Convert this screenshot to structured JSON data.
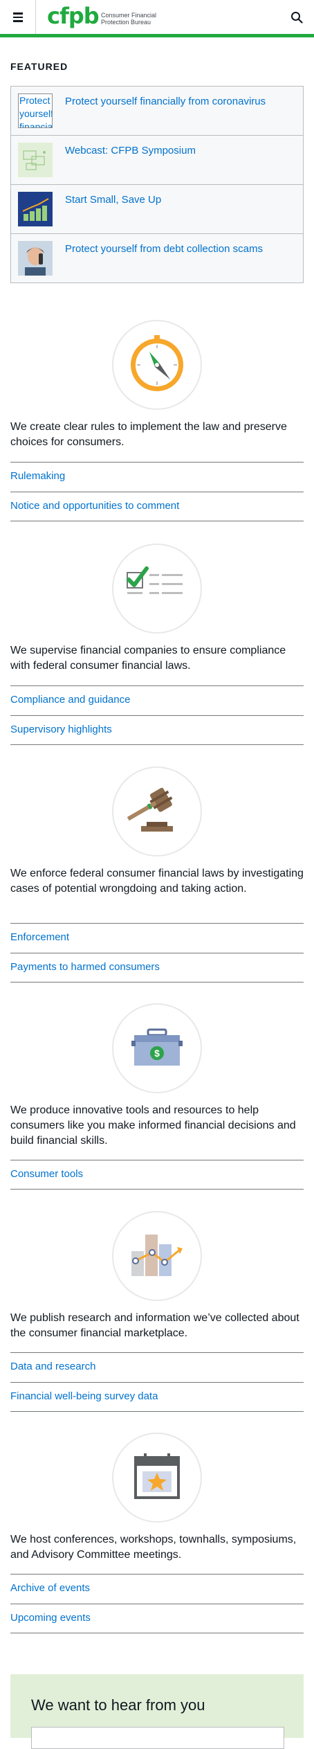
{
  "header": {
    "logo_text": "cfpb",
    "logo_subtitle_1": "Consumer Financial",
    "logo_subtitle_2": "Protection Bureau",
    "menu_icon": "hamburger-icon",
    "search_icon": "search-icon"
  },
  "featured": {
    "title": "FEATURED",
    "items": [
      {
        "label": "Protect yourself financially from coronavirus",
        "thumb_alt": "Protect yourself financially"
      },
      {
        "label": "Webcast: CFPB Symposium"
      },
      {
        "label": "Start Small, Save Up"
      },
      {
        "label": "Protect yourself from debt collection scams"
      }
    ]
  },
  "sections": [
    {
      "icon": "compass-icon",
      "text": "We create clear rules to implement the law and preserve choices for consumers.",
      "links": [
        "Rulemaking",
        "Notice and opportunities to comment"
      ]
    },
    {
      "icon": "checklist-icon",
      "text": "We supervise financial companies to ensure compliance with federal consumer financial laws.",
      "links": [
        "Compliance and guidance",
        "Supervisory highlights"
      ]
    },
    {
      "icon": "gavel-icon",
      "text": "We enforce federal consumer financial laws by investigating cases of potential wrongdoing and taking action.",
      "links": [
        "Enforcement",
        "Payments to harmed consumers"
      ]
    },
    {
      "icon": "toolbox-icon",
      "text": "We produce innovative tools and resources to help consumers like you make informed financial decisions and build financial skills.",
      "links": [
        "Consumer tools"
      ]
    },
    {
      "icon": "bar-chart-icon",
      "text": "We publish research and information we’ve collected about the consumer financial marketplace.",
      "links": [
        "Data and research",
        "Financial well-being survey data"
      ]
    },
    {
      "icon": "calendar-icon",
      "text": "We host conferences, workshops, townhalls, symposiums, and Advisory Committee meetings.",
      "links": [
        "Archive of events",
        "Upcoming events"
      ]
    }
  ],
  "feedback": {
    "title": "We want to hear from you"
  },
  "colors": {
    "brand_green": "#20aa3f",
    "link_blue": "#0072ce",
    "text": "#101820"
  }
}
